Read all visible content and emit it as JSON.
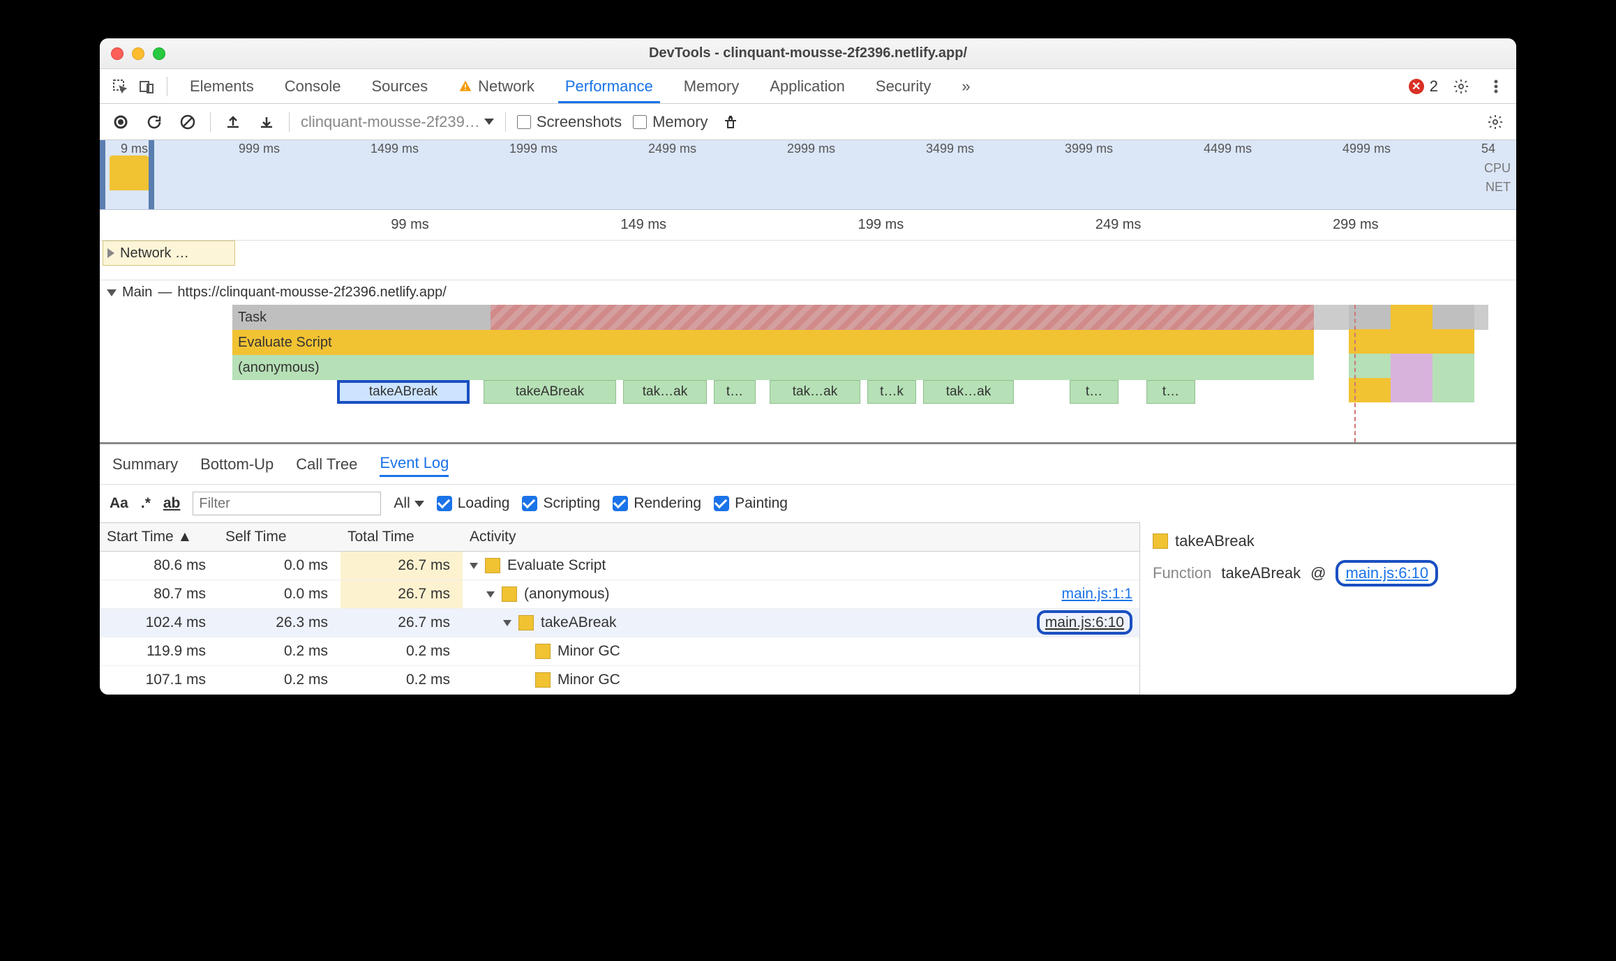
{
  "window": {
    "title": "DevTools - clinquant-mousse-2f2396.netlify.app/"
  },
  "tabs": {
    "items": [
      "Elements",
      "Console",
      "Sources",
      "Network",
      "Performance",
      "Memory",
      "Application",
      "Security"
    ],
    "more": "»",
    "active": "Performance",
    "error_count": "2"
  },
  "toolbar": {
    "profile_select": "clinquant-mousse-2f239…",
    "screenshots": "Screenshots",
    "memory": "Memory"
  },
  "overview": {
    "start_tick": "9 ms",
    "ticks": [
      "999 ms",
      "1499 ms",
      "1999 ms",
      "2499 ms",
      "2999 ms",
      "3499 ms",
      "3999 ms",
      "4499 ms",
      "4999 ms",
      "54"
    ],
    "right_labels": [
      "CPU",
      "NET"
    ]
  },
  "ruler": {
    "ticks": [
      "99 ms",
      "149 ms",
      "199 ms",
      "249 ms",
      "299 ms"
    ]
  },
  "network_lane": "Network …",
  "main_track": {
    "label": "Main",
    "url": "https://clinquant-mousse-2f2396.netlify.app/",
    "rows": {
      "task": "Task",
      "eval": "Evaluate Script",
      "anon": "(anonymous)"
    },
    "calls": [
      "takeABreak",
      "takeABreak",
      "tak…ak",
      "t…",
      "tak…ak",
      "t…k",
      "tak…ak",
      "t…",
      "t…"
    ]
  },
  "lowtabs": {
    "items": [
      "Summary",
      "Bottom-Up",
      "Call Tree",
      "Event Log"
    ],
    "active": "Event Log"
  },
  "filter": {
    "aa": "Aa",
    "regex": ".*",
    "ab": "ab",
    "placeholder": "Filter",
    "all": "All",
    "cb_loading": "Loading",
    "cb_scripting": "Scripting",
    "cb_rendering": "Rendering",
    "cb_painting": "Painting"
  },
  "table": {
    "headers": {
      "start": "Start Time",
      "self": "Self Time",
      "total": "Total Time",
      "activity": "Activity"
    },
    "rows": [
      {
        "start": "80.6 ms",
        "self": "0.0 ms",
        "total": "26.7 ms",
        "totalClass": "tot-warm",
        "depth": 0,
        "tri": true,
        "sq": "y",
        "act": "Evaluate Script",
        "src": ""
      },
      {
        "start": "80.7 ms",
        "self": "0.0 ms",
        "total": "26.7 ms",
        "totalClass": "tot-warm",
        "depth": 1,
        "tri": true,
        "sq": "y",
        "act": "(anonymous)",
        "src": "main.js:1:1"
      },
      {
        "start": "102.4 ms",
        "self": "26.3 ms",
        "total": "26.7 ms",
        "totalClass": "tot-blue",
        "depth": 2,
        "tri": true,
        "sq": "y",
        "act": "takeABreak",
        "src": "main.js:6:10",
        "ring": true,
        "sel": true
      },
      {
        "start": "119.9 ms",
        "self": "0.2 ms",
        "total": "0.2 ms",
        "totalClass": "",
        "depth": 3,
        "tri": false,
        "sq": "y",
        "act": "Minor GC",
        "src": ""
      },
      {
        "start": "107.1 ms",
        "self": "0.2 ms",
        "total": "0.2 ms",
        "totalClass": "",
        "depth": 3,
        "tri": false,
        "sq": "y",
        "act": "Minor GC",
        "src": ""
      }
    ]
  },
  "sidepanel": {
    "title": "takeABreak",
    "func_label": "Function",
    "func_name": "takeABreak",
    "at": "@",
    "src": "main.js:6:10"
  }
}
